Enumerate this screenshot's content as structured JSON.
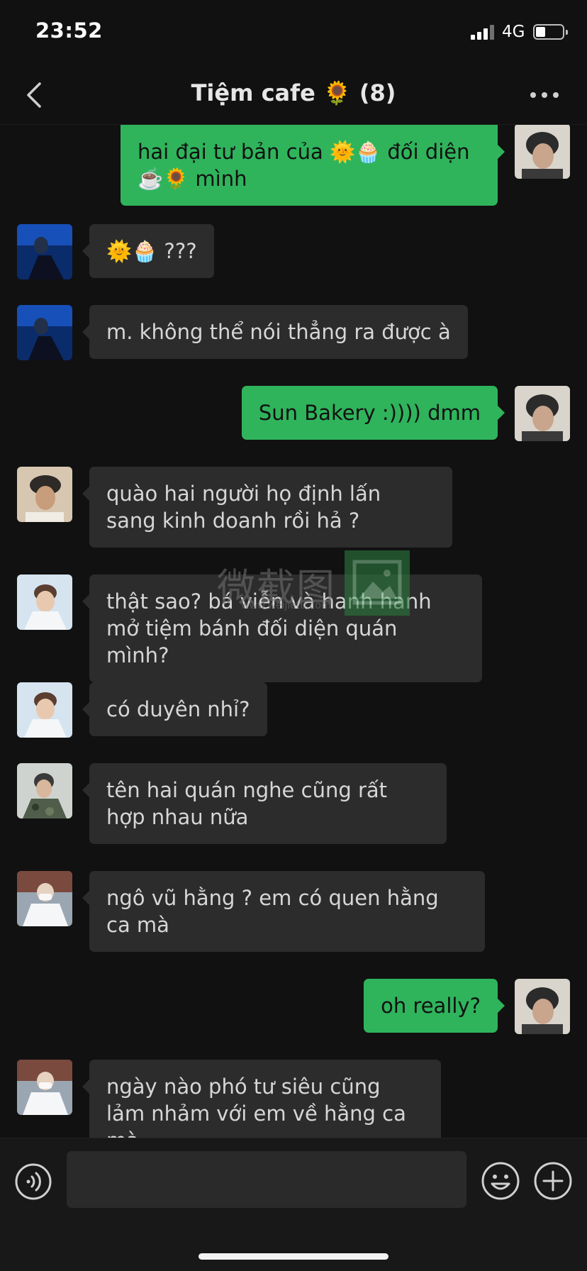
{
  "status_bar": {
    "time": "23:52",
    "network": "4G",
    "battery_level": 0.35
  },
  "nav": {
    "title": "Tiệm cafe 🌻 (8)",
    "back_icon": "chevron-left-icon",
    "more_icon": "more-dots-icon"
  },
  "messages": [
    {
      "side": "out",
      "text": "hai đại tư bản của 🌞🧁  đối diện ☕️🌻 mình"
    },
    {
      "side": "in",
      "text": "🌞🧁 ???"
    },
    {
      "side": "in",
      "text": "m. không thể nói thẳng ra được à"
    },
    {
      "side": "out",
      "text": "Sun Bakery :)))) dmm"
    },
    {
      "side": "in",
      "text": "quào hai người họ định lấn sang kinh doanh rồi hả ?"
    },
    {
      "side": "in",
      "text": "thật sao? bá viễn và hanh hanh mở tiệm bánh đối diện quán mình?"
    },
    {
      "side": "in",
      "text": "có duyên nhỉ?"
    },
    {
      "side": "in",
      "text": "tên hai quán nghe cũng rất hợp nhau nữa"
    },
    {
      "side": "in",
      "text": "ngô vũ hằng ? em có quen hằng ca mà"
    },
    {
      "side": "out",
      "text": "oh really?"
    },
    {
      "side": "in",
      "text": "ngày nào phó tư siêu cũng lảm nhảm với em về hằng ca mà"
    }
  ],
  "watermark": {
    "text": "微截图",
    "url": "www.weijietu.com"
  },
  "input": {
    "value": "",
    "voice_icon": "voice-wave-icon",
    "emoji_icon": "smiley-icon",
    "plus_icon": "plus-circle-icon"
  },
  "colors": {
    "background": "#111111",
    "bubble_in": "#2c2c2c",
    "bubble_out": "#2fb45c"
  }
}
